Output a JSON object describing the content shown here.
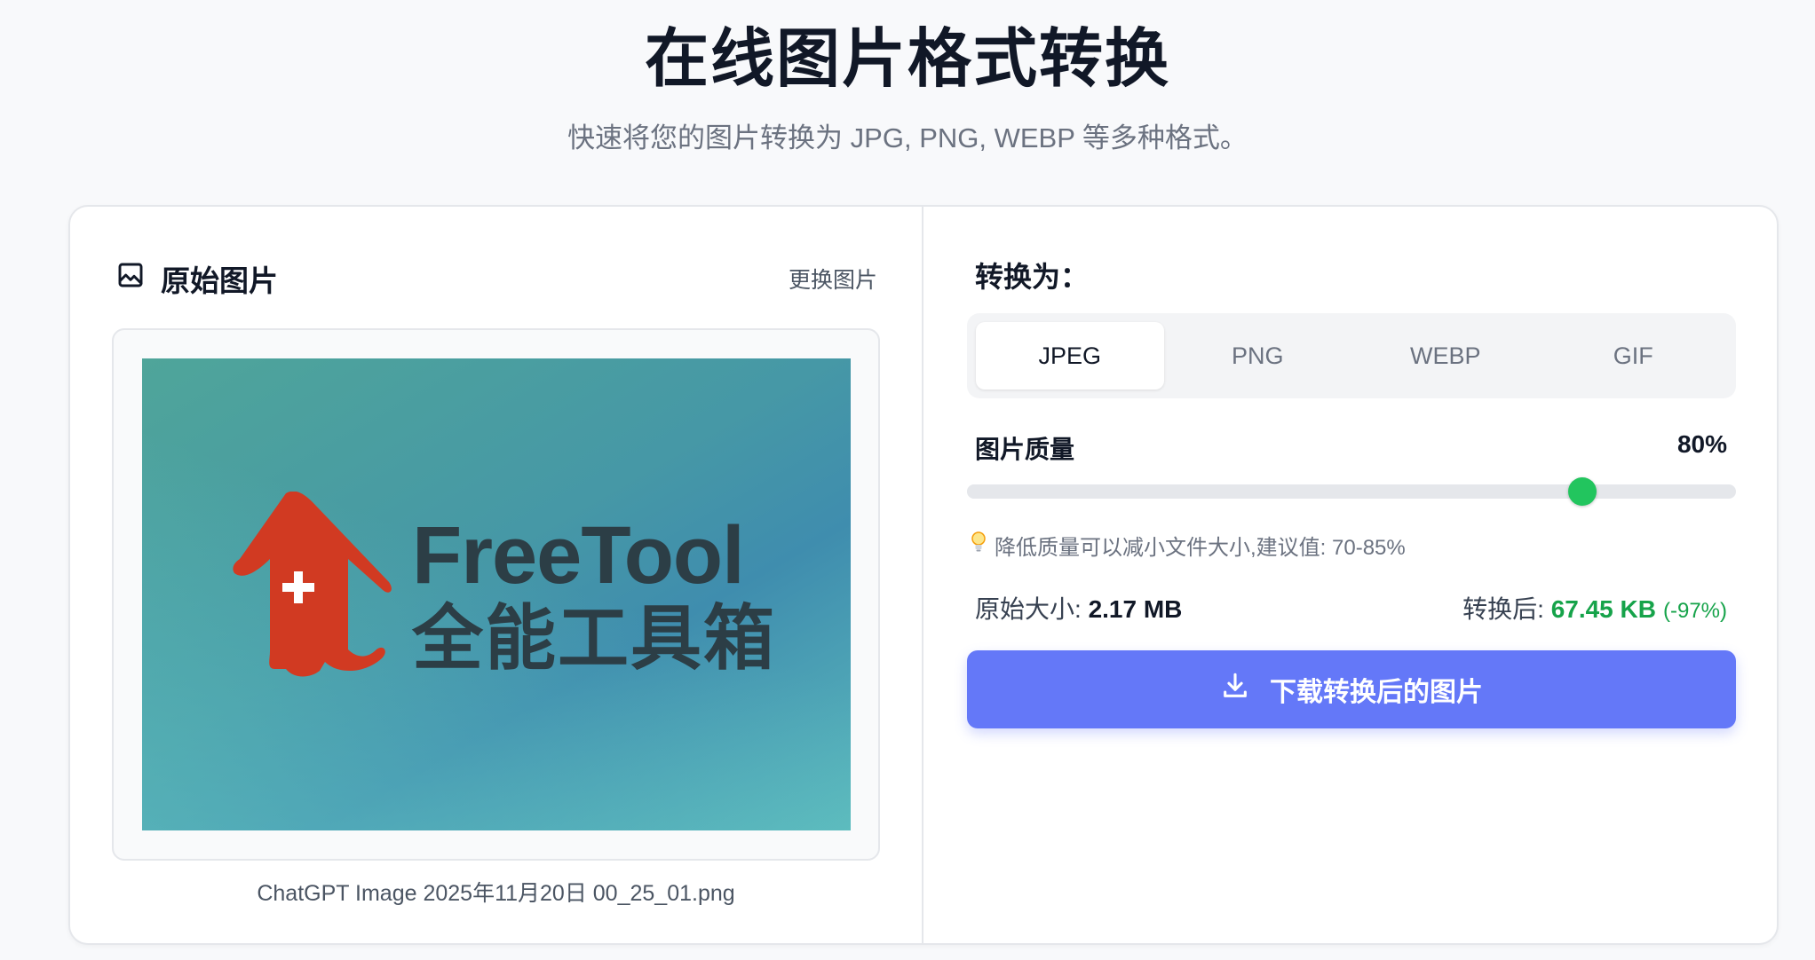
{
  "header": {
    "title": "在线图片格式转换",
    "subtitle": "快速将您的图片转换为 JPG, PNG, WEBP 等多种格式。"
  },
  "left_panel": {
    "title": "原始图片",
    "change_link": "更换图片",
    "image": {
      "logo_text_en": "FreeTool",
      "logo_text_cn": "全能工具箱",
      "colors": {
        "logo_red": "#d13a22",
        "text": "#2c3e46"
      }
    },
    "filename": "ChatGPT Image 2025年11月20日 00_25_01.png"
  },
  "right_panel": {
    "convert_label": "转换为：",
    "formats": [
      {
        "label": "JPEG",
        "selected": true
      },
      {
        "label": "PNG",
        "selected": false
      },
      {
        "label": "WEBP",
        "selected": false
      },
      {
        "label": "GIF",
        "selected": false
      }
    ],
    "quality": {
      "label": "图片质量",
      "value_text": "80%",
      "value": 80
    },
    "tip": "降低质量可以减小文件大小,建议值: 70-85%",
    "original_size": {
      "label": "原始大小:",
      "value": "2.17 MB"
    },
    "converted_size": {
      "label": "转换后:",
      "value": "67.45 KB",
      "change": "(-97%)"
    },
    "download_button": "下载转换后的图片"
  },
  "colors": {
    "accent": "#6478f8",
    "success": "#22c55e",
    "success_text": "#16a34a"
  }
}
